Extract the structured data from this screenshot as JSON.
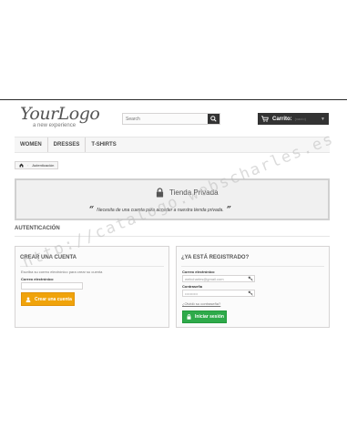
{
  "header": {
    "logo_main": "YourLogo",
    "logo_tagline": "a new experience",
    "search_placeholder": "Search",
    "cart_label": "Carrito:",
    "cart_value": "(vacío)"
  },
  "menu": [
    "WOMEN",
    "DRESSES",
    "T-SHIRTS"
  ],
  "breadcrumb": {
    "current": "Autenticación"
  },
  "banner": {
    "title": "Tienda Privada",
    "message": "Necesita de una cuenta para acceder a nuestra tienda privada."
  },
  "section_title": "AUTENTICACIÓN",
  "create_account": {
    "title": "CREAR UNA CUENTA",
    "help": "Escriba su correo electrónico para crear su cuenta",
    "email_label": "Correo electrónico",
    "button": "Crear una cuenta"
  },
  "login": {
    "title": "¿YA ESTÁ REGISTRADO?",
    "email_label": "Correo electrónico",
    "email_value": "webcharles@gmail.com",
    "password_label": "Contraseña",
    "password_value": "••••••••••",
    "forgot_link": "¿Olvidó su contraseña?",
    "button": "Iniciar sesión"
  },
  "watermark": "http://catalogo.webscharles.es",
  "colors": {
    "orange": "#f0a30a",
    "green": "#2eaa4a",
    "dark": "#333333"
  }
}
